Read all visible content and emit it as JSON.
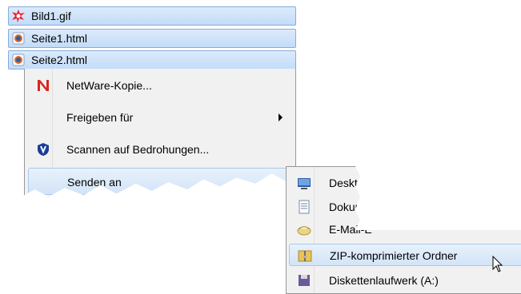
{
  "files": [
    {
      "name": "Bild1.gif",
      "icon": "gif-image-icon"
    },
    {
      "name": "Seite1.html",
      "icon": "firefox-html-icon"
    },
    {
      "name": "Seite2.html",
      "icon": "firefox-html-icon"
    }
  ],
  "context_menu": {
    "items": [
      {
        "label": "NetWare-Kopie...",
        "icon": "netware-icon"
      },
      {
        "label": "Freigeben für",
        "submenu": true
      },
      {
        "label": "Scannen auf Bedrohungen...",
        "icon": "shield-icon"
      },
      {
        "label": "Senden an",
        "submenu": true
      }
    ]
  },
  "send_to_menu": {
    "items": [
      {
        "label": "Deskt",
        "icon": "desktop-icon"
      },
      {
        "label": "Dokun",
        "icon": "documents-icon"
      },
      {
        "label": "E-Mail-E",
        "icon": "mail-icon"
      },
      {
        "label": "ZIP-komprimierter Ordner",
        "icon": "zip-folder-icon"
      },
      {
        "label": "Diskettenlaufwerk (A:)",
        "icon": "floppy-icon"
      }
    ]
  },
  "colors": {
    "selection": "#c3dcf8",
    "menu_bg": "#f1f1f1",
    "netware_red": "#d8281c"
  }
}
